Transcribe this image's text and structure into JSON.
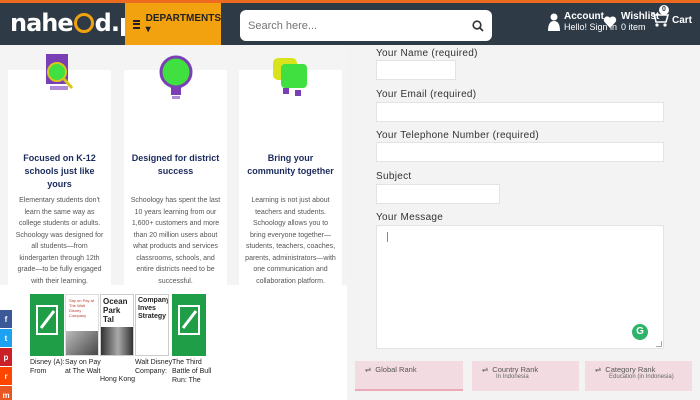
{
  "header": {
    "logo_left": "nahe",
    "logo_right": "d.pk",
    "departments_label": "DEPARTMENTS ▾",
    "search_placeholder": "Search here...",
    "account_title": "Account",
    "account_sub": "Hello! Sign in",
    "wishlist_title": "Wishlist",
    "wishlist_sub": "0 item",
    "cart_label": "Cart",
    "cart_count": "0"
  },
  "features": [
    {
      "icon": "magnifier-icon",
      "title": "Focused on K-12 schools just like yours",
      "text": "Elementary students don't learn the same way as college students or adults. Schoology was designed for all students—from kindergarten through 12th grade—to be fully engaged with their learning."
    },
    {
      "icon": "lightbulb-icon",
      "title": "Designed for district success",
      "text": "Schoology has spent the last 10 years learning from our 1,600+ customers and more than 20 million users about what products and services classrooms, schools, and entire districts need to be successful."
    },
    {
      "icon": "chat-bubbles-icon",
      "title": "Bring your community together",
      "text": "Learning is not just about teachers and students. Schoology allows you to bring everyone together—students, teachers, coaches, parents, administrators—with one communication and collaboration platform."
    }
  ],
  "books": [
    {
      "caption": "Disney (A): From",
      "cover_text": ""
    },
    {
      "caption": "Say on Pay at The Walt",
      "cover_text": "Say on Pay at The Walt Disney Company"
    },
    {
      "caption": "Hong Kong",
      "cover_text": "Ocean Park Tal"
    },
    {
      "caption": "Walt Disney Company:",
      "cover_text": "Company Inves Strategy"
    },
    {
      "caption": "The Third Battle of Bull Run: The",
      "cover_text": ""
    }
  ],
  "social_icons": [
    "facebook-icon",
    "twitter-icon",
    "pinterest-icon",
    "reddit-icon",
    "mix-icon"
  ],
  "form": {
    "name_label": "Your Name (required)",
    "email_label": "Your Email (required)",
    "phone_label": "Your Telephone Number (required)",
    "subject_label": "Subject",
    "message_label": "Your Message",
    "grammarly": "G"
  },
  "ranks": [
    {
      "title": "Global Rank",
      "sub": ""
    },
    {
      "title": "Country Rank",
      "sub": "In Indonesia"
    },
    {
      "title": "Category Rank",
      "sub": "Education (in Indonesia)"
    }
  ],
  "colors": {
    "header_bg": "#2f3a47",
    "accent": "#f3a20f",
    "top_bar": "#ec6b1e",
    "title_navy": "#1a2a5c",
    "rank_pink": "#f2dce2"
  }
}
